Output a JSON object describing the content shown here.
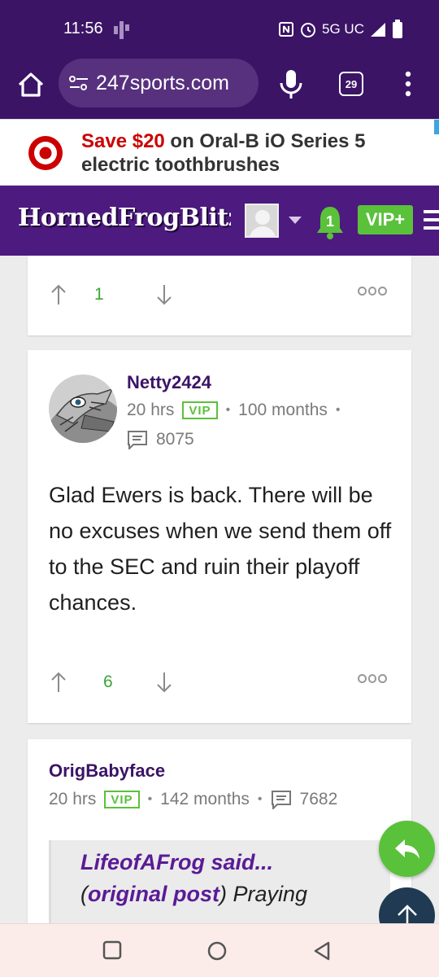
{
  "status_bar": {
    "time": "11:56",
    "network": "5G UC",
    "icons": [
      "nfc-icon",
      "alarm-icon",
      "signal-icon",
      "battery-icon"
    ]
  },
  "browser": {
    "url": "247sports.com",
    "tab_count": "29",
    "icons": [
      "home-icon",
      "site-settings-icon",
      "mic-icon",
      "tabs-icon",
      "overflow-menu-icon"
    ]
  },
  "ad": {
    "highlight": "Save $20",
    "line1_rest": " on Oral-B iO Series 5",
    "line2": "electric toothbrushes",
    "brand_color": "#cc0000"
  },
  "site_header": {
    "logo_text": "HornedFrogBlitz",
    "notification_count": "1",
    "vip_button": "VIP+"
  },
  "posts": [
    {
      "votes": "1"
    },
    {
      "author": "Netty2424",
      "time": "20 hrs",
      "badge": "VIP",
      "tenure": "100 months",
      "post_count": "8075",
      "body": "Glad Ewers is back. There will be no excuses when we send them off to the SEC and ruin their playoff chances.",
      "votes": "6"
    },
    {
      "author": "OrigBabyface",
      "time": "20 hrs",
      "badge": "VIP",
      "tenure": "142 months",
      "post_count": "7682",
      "quote": {
        "author": "LifeofAFrog said...",
        "link": "original post",
        "text": "Praying"
      }
    }
  ],
  "colors": {
    "header_purple": "#4d1a7f",
    "status_purple": "#3b1466",
    "green": "#5ac13b",
    "author_purple": "#3b1466"
  }
}
